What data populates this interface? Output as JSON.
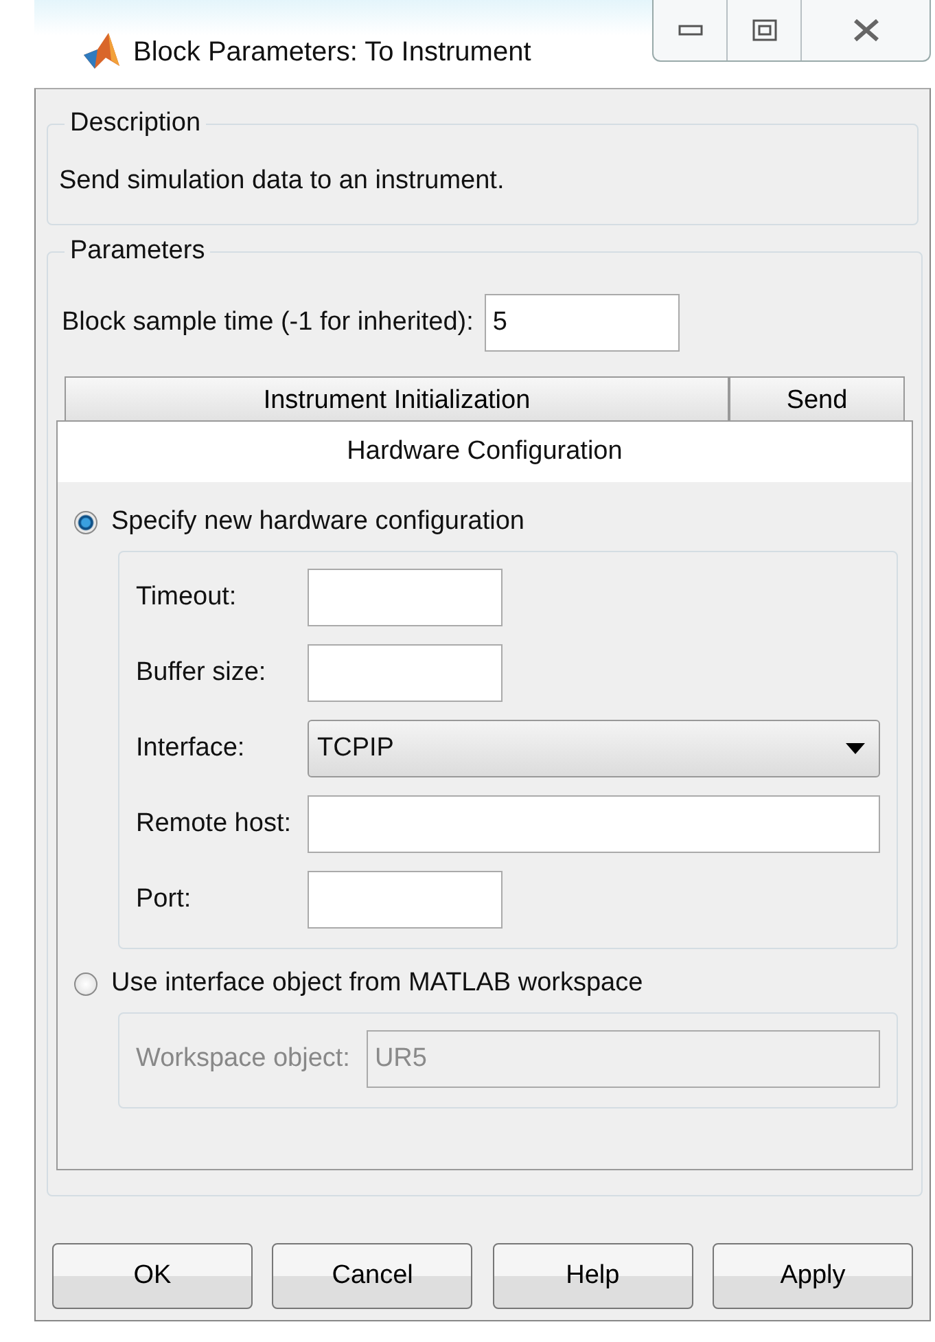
{
  "window": {
    "title": "Block Parameters: To Instrument"
  },
  "description": {
    "legend": "Description",
    "text": "Send simulation data to an instrument."
  },
  "parameters": {
    "legend": "Parameters",
    "sample_time": {
      "label": "Block sample time (-1 for inherited):",
      "value": "5"
    },
    "tabs": [
      {
        "label": "Instrument Initialization"
      },
      {
        "label": "Send"
      }
    ],
    "panel": {
      "title": "Hardware Configuration",
      "options": [
        {
          "label": "Specify new hardware configuration",
          "selected": true,
          "disabled": false,
          "fields": [
            {
              "kind": "number",
              "label": "Timeout:"
            },
            {
              "kind": "number",
              "label": "Buffer size:"
            },
            {
              "kind": "select",
              "label": "Interface:",
              "value": "TCPIP"
            },
            {
              "kind": "text",
              "label": "Remote host:"
            },
            {
              "kind": "number",
              "label": "Port:"
            }
          ]
        },
        {
          "label": "Use interface object from MATLAB workspace",
          "selected": false,
          "disabled": true,
          "fields": [
            {
              "kind": "text",
              "label": "Workspace object:",
              "value": "UR5"
            }
          ]
        }
      ]
    }
  },
  "buttons": [
    "OK",
    "Cancel",
    "Help",
    "Apply"
  ]
}
